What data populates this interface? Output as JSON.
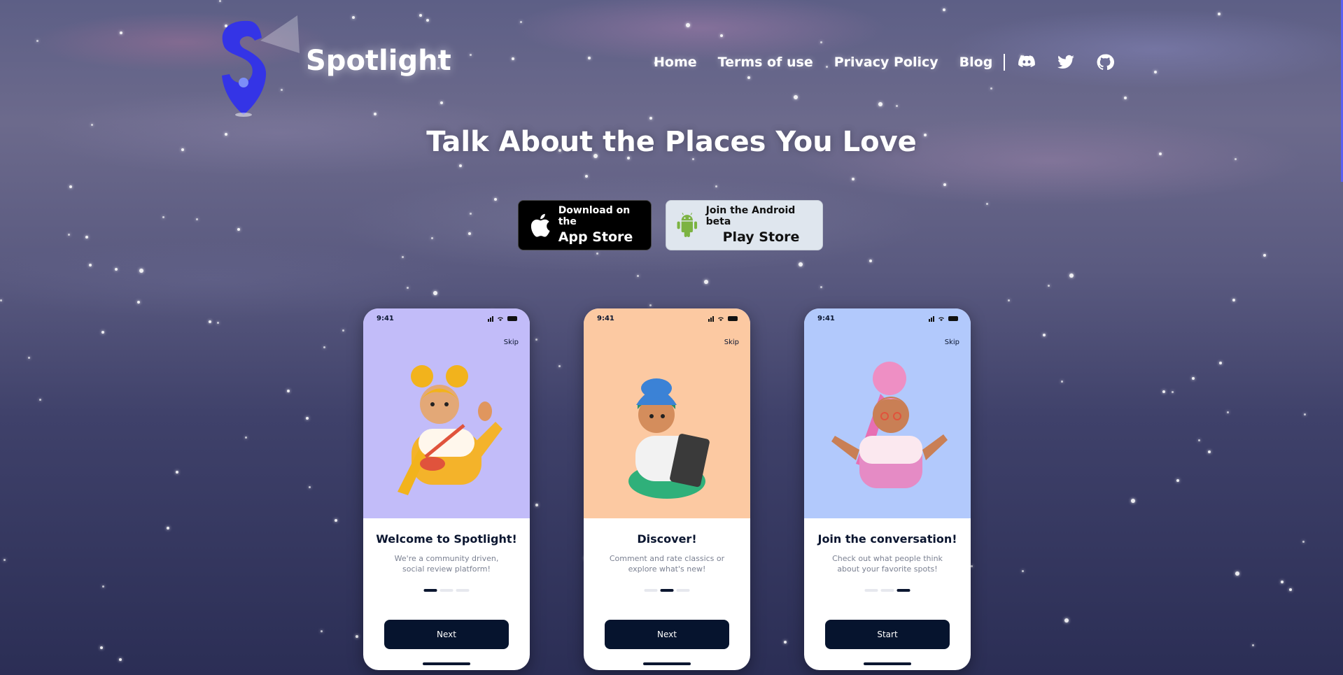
{
  "brand": {
    "name": "Spotlight",
    "logo_icon": "spotlight-s-pin-logo",
    "accent": "#3b3fe0"
  },
  "nav": {
    "links": [
      "Home",
      "Terms of use",
      "Privacy Policy",
      "Blog"
    ],
    "icons": [
      "discord-icon",
      "twitter-icon",
      "github-icon"
    ]
  },
  "hero": {
    "title": "Talk About the Places You Love"
  },
  "stores": {
    "apple": {
      "small": "Download on the",
      "big": "App Store",
      "icon": "apple-icon"
    },
    "android": {
      "small": "Join the Android beta",
      "big": "Play Store",
      "icon": "android-icon"
    }
  },
  "phones": [
    {
      "time": "9:41",
      "skip": "Skip",
      "title": "Welcome to Spotlight!",
      "desc": "We're a community driven, social review platform!",
      "button": "Next",
      "bg": "#c2bcf9",
      "active_dot": 0
    },
    {
      "time": "9:41",
      "skip": "Skip",
      "title": "Discover!",
      "desc": "Comment and rate classics or explore what's new!",
      "button": "Next",
      "bg": "#fcc9a2",
      "active_dot": 1
    },
    {
      "time": "9:41",
      "skip": "Skip",
      "title": "Join the conversation!",
      "desc": "Check out what people think about your favorite spots!",
      "button": "Start",
      "bg": "#b2c9fc",
      "active_dot": 2
    }
  ]
}
